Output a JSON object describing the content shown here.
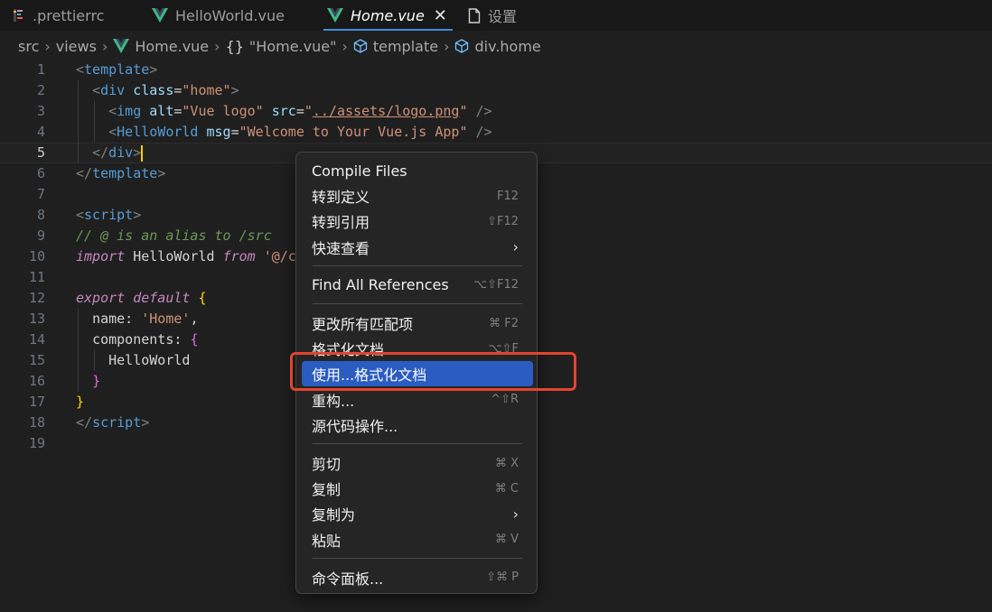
{
  "tabs": [
    {
      "label": ".prettierrc",
      "icon": "prettier-file-icon"
    },
    {
      "label": "HelloWorld.vue",
      "icon": "vue-file-icon"
    },
    {
      "label": "Home.vue",
      "icon": "vue-file-icon",
      "active": true,
      "close": "✕"
    },
    {
      "label": "设置",
      "icon": "file-icon"
    }
  ],
  "breadcrumb": [
    {
      "label": "src"
    },
    {
      "label": "views"
    },
    {
      "label": "Home.vue",
      "icon": "vue-file-icon"
    },
    {
      "label": "\"Home.vue\"",
      "icon": "{}"
    },
    {
      "label": "template",
      "icon": "cube-icon"
    },
    {
      "label": "div.home",
      "icon": "cube-icon"
    }
  ],
  "editor": {
    "line_numbers": [
      "1",
      "2",
      "3",
      "4",
      "5",
      "6",
      "7",
      "8",
      "9",
      "10",
      "11",
      "12",
      "13",
      "14",
      "15",
      "16",
      "17",
      "18",
      "19"
    ],
    "current_line": "5",
    "lines": [
      [
        {
          "t": "<",
          "c": "br"
        },
        {
          "t": "template",
          "c": "tg"
        },
        {
          "t": ">",
          "c": "br"
        }
      ],
      [
        {
          "t": "  "
        },
        {
          "t": "<",
          "c": "br"
        },
        {
          "t": "div",
          "c": "tg"
        },
        {
          "t": " "
        },
        {
          "t": "class",
          "c": "at"
        },
        {
          "t": "=",
          "c": "id"
        },
        {
          "t": "\"home\"",
          "c": "st"
        },
        {
          "t": ">",
          "c": "br"
        }
      ],
      [
        {
          "t": "    "
        },
        {
          "t": "<",
          "c": "br"
        },
        {
          "t": "img",
          "c": "tg"
        },
        {
          "t": " "
        },
        {
          "t": "alt",
          "c": "at"
        },
        {
          "t": "=",
          "c": "id"
        },
        {
          "t": "\"Vue logo\"",
          "c": "st"
        },
        {
          "t": " "
        },
        {
          "t": "src",
          "c": "at"
        },
        {
          "t": "=",
          "c": "id"
        },
        {
          "t": "\"",
          "c": "st"
        },
        {
          "t": "../assets/logo.png",
          "c": "st ul"
        },
        {
          "t": "\"",
          "c": "st"
        },
        {
          "t": " "
        },
        {
          "t": "/>",
          "c": "br"
        }
      ],
      [
        {
          "t": "    "
        },
        {
          "t": "<",
          "c": "br"
        },
        {
          "t": "HelloWorld",
          "c": "tg"
        },
        {
          "t": " "
        },
        {
          "t": "msg",
          "c": "at"
        },
        {
          "t": "=",
          "c": "id"
        },
        {
          "t": "\"Welcome to Your Vue.js App\"",
          "c": "st"
        },
        {
          "t": " "
        },
        {
          "t": "/>",
          "c": "br"
        }
      ],
      [
        {
          "t": "  "
        },
        {
          "t": "</",
          "c": "br"
        },
        {
          "t": "div",
          "c": "tg"
        },
        {
          "t": ">",
          "c": "br"
        }
      ],
      [
        {
          "t": "</",
          "c": "br"
        },
        {
          "t": "template",
          "c": "tg"
        },
        {
          "t": ">",
          "c": "br"
        }
      ],
      [],
      [
        {
          "t": "<",
          "c": "br"
        },
        {
          "t": "script",
          "c": "tg"
        },
        {
          "t": ">",
          "c": "br"
        }
      ],
      [
        {
          "t": "// @ is an alias to /src",
          "c": "cm"
        }
      ],
      [
        {
          "t": "import",
          "c": "kw"
        },
        {
          "t": " HelloWorld ",
          "c": "id"
        },
        {
          "t": "from",
          "c": "kw"
        },
        {
          "t": " "
        },
        {
          "t": "'@/c",
          "c": "st"
        }
      ],
      [],
      [
        {
          "t": "export",
          "c": "kw"
        },
        {
          "t": " "
        },
        {
          "t": "default",
          "c": "kw"
        },
        {
          "t": " "
        },
        {
          "t": "{",
          "c": "yb"
        }
      ],
      [
        {
          "t": "  "
        },
        {
          "t": "name:",
          "c": "id"
        },
        {
          "t": " "
        },
        {
          "t": "'Home'",
          "c": "st"
        },
        {
          "t": ",",
          "c": "id"
        }
      ],
      [
        {
          "t": "  "
        },
        {
          "t": "components:",
          "c": "id"
        },
        {
          "t": " "
        },
        {
          "t": "{",
          "c": "pb"
        }
      ],
      [
        {
          "t": "    "
        },
        {
          "t": "HelloWorld",
          "c": "id"
        }
      ],
      [
        {
          "t": "  "
        },
        {
          "t": "}",
          "c": "pb"
        }
      ],
      [
        {
          "t": "}",
          "c": "yb"
        }
      ],
      [
        {
          "t": "</",
          "c": "br"
        },
        {
          "t": "script",
          "c": "tg"
        },
        {
          "t": ">",
          "c": "br"
        }
      ],
      []
    ]
  },
  "context_menu": {
    "groups": [
      [
        {
          "label": "Compile Files",
          "shortcut": ""
        },
        {
          "label": "转到定义",
          "shortcut": "F12"
        },
        {
          "label": "转到引用",
          "shortcut": "⇧F12"
        },
        {
          "label": "快速查看",
          "shortcut": "",
          "submenu": true
        }
      ],
      [
        {
          "label": "Find All References",
          "shortcut": "⌥⇧F12"
        }
      ],
      [
        {
          "label": "更改所有匹配项",
          "shortcut": "⌘ F2"
        },
        {
          "label": "格式化文档",
          "shortcut": "⌥⇧F"
        },
        {
          "label": "使用...格式化文档",
          "shortcut": "",
          "highlighted": true
        },
        {
          "label": "重构...",
          "shortcut": "^⇧R"
        },
        {
          "label": "源代码操作...",
          "shortcut": ""
        }
      ],
      [
        {
          "label": "剪切",
          "shortcut": "⌘ X"
        },
        {
          "label": "复制",
          "shortcut": "⌘ C"
        },
        {
          "label": "复制为",
          "shortcut": "",
          "submenu": true
        },
        {
          "label": "粘贴",
          "shortcut": "⌘ V"
        }
      ],
      [
        {
          "label": "命令面板...",
          "shortcut": "⇧⌘ P"
        }
      ]
    ],
    "submenu_chevron": "›"
  },
  "colors": {
    "highlight": "#2a5cc2",
    "annotation_box": "#e2442f",
    "vue_green": "#41b883"
  }
}
